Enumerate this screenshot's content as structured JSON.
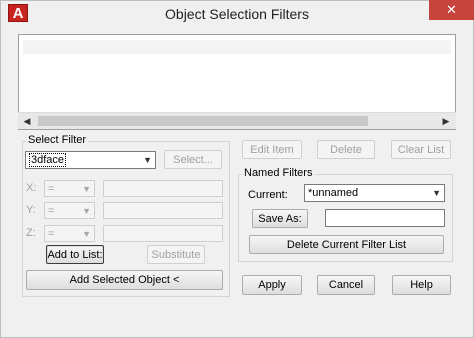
{
  "window": {
    "title": "Object Selection Filters",
    "app_icon_letter": "A",
    "close_glyph": "✕"
  },
  "scrollbar": {
    "left_glyph": "◀",
    "right_glyph": "▶"
  },
  "select_filter": {
    "group_label": "Select Filter",
    "type_value": "3dface",
    "select_button": "Select...",
    "x_label": "X:",
    "y_label": "Y:",
    "z_label": "Z:",
    "operator_value": "=",
    "add_to_list_button": "Add to List:",
    "substitute_button": "Substitute",
    "add_selected_object_button": "Add Selected Object <"
  },
  "list_actions": {
    "edit_item": "Edit Item",
    "delete": "Delete",
    "clear_list": "Clear List"
  },
  "named_filters": {
    "group_label": "Named Filters",
    "current_label": "Current:",
    "current_value": "*unnamed",
    "save_as_button": "Save As:",
    "save_as_value": "",
    "delete_current_button": "Delete Current Filter List"
  },
  "footer": {
    "apply": "Apply",
    "cancel": "Cancel",
    "help": "Help"
  },
  "icons": {
    "dropdown_arrow": "chevron-down-icon",
    "close": "close-icon"
  }
}
